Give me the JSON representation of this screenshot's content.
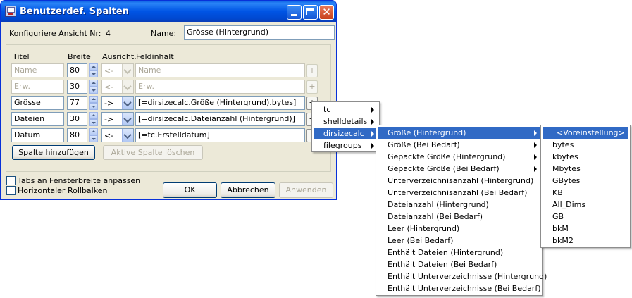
{
  "window": {
    "title": "Benutzerdef. Spalten",
    "close_glyph": "✕"
  },
  "header": {
    "view_label": "Konfiguriere Ansicht Nr:",
    "view_number": "4",
    "name_label": "Name:",
    "name_value": "Grösse (Hintergrund)"
  },
  "columns": {
    "title": "Titel",
    "width": "Breite",
    "align": "Ausricht.",
    "content": "Feldinhalt"
  },
  "rows": [
    {
      "title": "Name",
      "width": "80",
      "align": "<-",
      "content": "Name",
      "enabled": false,
      "plus": "+"
    },
    {
      "title": "Erw.",
      "width": "30",
      "align": "<-",
      "content": "Erw.",
      "enabled": false,
      "plus": "+"
    },
    {
      "title": "Grösse",
      "width": "77",
      "align": "->",
      "content": "[=dirsizecalc.Größe (Hintergrund).bytes]",
      "enabled": true,
      "plus": "+"
    },
    {
      "title": "Dateien",
      "width": "30",
      "align": "->",
      "content": "[=dirsizecalc.Dateianzahl (Hintergrund)]",
      "enabled": true,
      "plus": "+"
    },
    {
      "title": "Datum",
      "width": "80",
      "align": "<-",
      "content": "[=tc.Erstelldatum]",
      "enabled": true,
      "plus": "+"
    }
  ],
  "buttons": {
    "add_column": "Spalte hinzufügen",
    "delete_column": "Aktive Spalte löschen",
    "ok": "OK",
    "cancel": "Abbrechen",
    "apply": "Anwenden"
  },
  "checkboxes": {
    "fit_tabs": "Tabs an Fensterbreite anpassen",
    "horizontal_scroll": "Horizontaler Rollbalken"
  },
  "menu1": {
    "items": [
      "tc",
      "shelldetails",
      "dirsizecalc",
      "filegroups"
    ],
    "selected_index": 2
  },
  "menu2": {
    "items": [
      "Größe (Hintergrund)",
      "Größe (Bei Bedarf)",
      "Gepackte Größe (Hintergrund)",
      "Gepackte Größe (Bei Bedarf)",
      "Unterverzeichnisanzahl (Hintergrund)",
      "Unterverzeichnisanzahl (Bei Bedarf)",
      "Dateianzahl (Hintergrund)",
      "Dateianzahl (Bei Bedarf)",
      "Leer (Hintergrund)",
      "Leer (Bei Bedarf)",
      "Enthält Dateien (Hintergrund)",
      "Enthält Dateien (Bei Bedarf)",
      "Enthält Unterverzeichnisse (Hintergrund)",
      "Enthält Unterverzeichnisse (Bei Bedarf)"
    ],
    "selected_index": 0,
    "submenu_count": 4
  },
  "menu3": {
    "items": [
      "<Voreinstellung>",
      "bytes",
      "kbytes",
      "Mbytes",
      "GBytes",
      "KB",
      "All_Dims",
      "GB",
      "bkM",
      "bkM2"
    ],
    "selected_index": 0
  },
  "colors": {
    "title_bar": "#0055e5",
    "dialog_bg": "#ece9d8",
    "menu_highlight": "#316ac5"
  }
}
